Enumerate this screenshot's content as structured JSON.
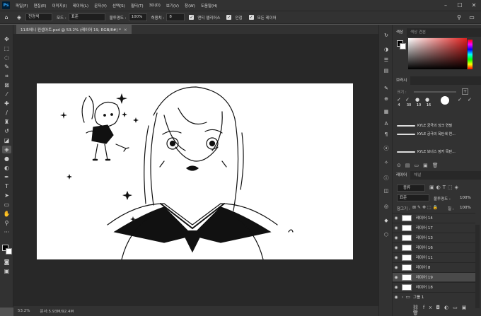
{
  "app": {
    "logo": "Ps"
  },
  "menu": [
    "파일(F)",
    "편집(E)",
    "이미지(I)",
    "레이어(L)",
    "문자(Y)",
    "선택(S)",
    "필터(T)",
    "3D(D)",
    "보기(V)",
    "창(W)",
    "도움말(H)"
  ],
  "options": {
    "blend_value": "전경색",
    "mode_label": "모드 :",
    "mode_value": "표준",
    "opacity_label": "불투명도 :",
    "opacity_value": "100%",
    "tolerance_label": "허용치 :",
    "tolerance_value": "8",
    "antialias_label": "앤티 앨리어스",
    "contiguous_label": "인접",
    "all_layers_label": "모든 레이어"
  },
  "document": {
    "tab_title": "11초에니 컨셉아트.psd @ 53.2% (레이어 19, RGB/8#) *",
    "zoom": "53.2%",
    "doc_info": "문서:5.93M/92.4M"
  },
  "color_panel": {
    "tabs": [
      "색상",
      "색상 견본"
    ]
  },
  "brush_panel": {
    "tab": "브러시",
    "size_label": "크기 :",
    "tip_sizes": [
      "4",
      "30",
      "10",
      "16"
    ],
    "brushes": [
      "KYLE 궁극의 잉크 연필",
      "KYLE 궁극의 목탄색 연...",
      "KYLE 보너스 정커 목탄..."
    ]
  },
  "layers_panel": {
    "tabs": [
      "레이어",
      "채널"
    ],
    "filter_value": "종류",
    "blend_value": "표준",
    "opacity_label": "불투명도 :",
    "opacity_value": "100%",
    "lock_label": "잠그기 :",
    "fill_label": "칠 :",
    "fill_value": "100%",
    "layers": [
      "레이어 14",
      "레이어 17",
      "레이어 13",
      "레이어 16",
      "레이어 11",
      "레이어 8",
      "레이어 19",
      "레이어 18"
    ],
    "selected_layer": "레이어 19",
    "group_name": "그룹 1"
  }
}
